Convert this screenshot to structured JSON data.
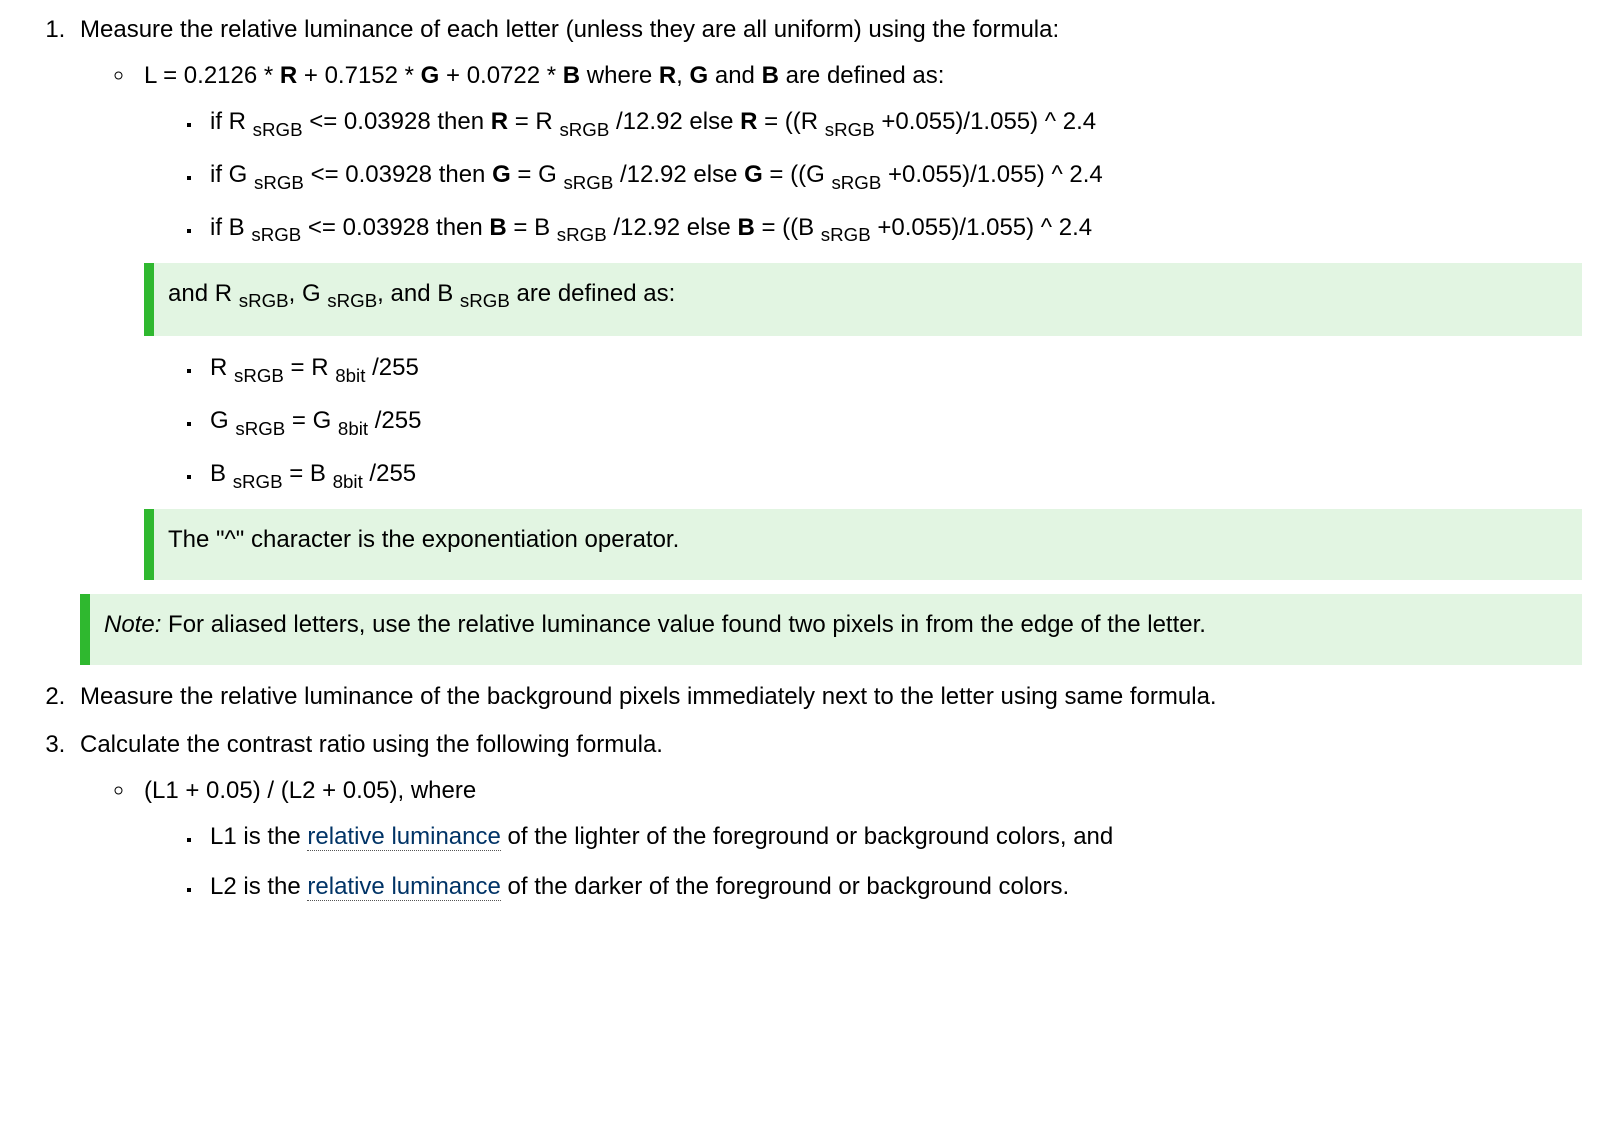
{
  "step1": {
    "text": "Measure the relative luminance of each letter (unless they are all uniform) using the formula:",
    "formula_pre": "L = 0.2126 * ",
    "formula_R": "R",
    "formula_mid1": " + 0.7152 * ",
    "formula_G": "G",
    "formula_mid2": " + 0.0722 * ",
    "formula_B": "B",
    "formula_where": " where ",
    "formula_R2": "R",
    "formula_comma": ", ",
    "formula_G2": "G",
    "formula_and": " and ",
    "formula_B2": "B",
    "formula_post": " are defined as:",
    "r_line_1": "if R ",
    "r_line_sub1": "sRGB",
    "r_line_2": " <= 0.03928 then ",
    "r_line_bold1": "R",
    "r_line_3": " = R ",
    "r_line_sub2": "sRGB",
    "r_line_4": " /12.92 else ",
    "r_line_bold2": "R",
    "r_line_5": " = ((R ",
    "r_line_sub3": "sRGB",
    "r_line_6": " +0.055)/1.055) ^ 2.4",
    "g_line_1": "if G ",
    "g_line_sub1": "sRGB",
    "g_line_2": " <= 0.03928 then ",
    "g_line_bold1": "G",
    "g_line_3": " = G ",
    "g_line_sub2": "sRGB",
    "g_line_4": " /12.92 else ",
    "g_line_bold2": "G",
    "g_line_5": " = ((G ",
    "g_line_sub3": "sRGB",
    "g_line_6": " +0.055)/1.055) ^ 2.4",
    "b_line_1": "if B ",
    "b_line_sub1": "sRGB",
    "b_line_2": " <= 0.03928 then ",
    "b_line_bold1": "B",
    "b_line_3": " = B ",
    "b_line_sub2": "sRGB",
    "b_line_4": " /12.92 else ",
    "b_line_bold2": "B",
    "b_line_5": " = ((B ",
    "b_line_sub3": "sRGB",
    "b_line_6": " +0.055)/1.055) ^ 2.4",
    "def_box_1": "and R ",
    "def_box_sub1": "sRGB",
    "def_box_2": ", G ",
    "def_box_sub2": "sRGB",
    "def_box_3": ", and B ",
    "def_box_sub3": "sRGB",
    "def_box_4": " are defined as:",
    "r8_1": "R ",
    "r8_sub1": "sRGB",
    "r8_2": " = R ",
    "r8_sub2": "8bit",
    "r8_3": " /255",
    "g8_1": "G ",
    "g8_sub1": "sRGB",
    "g8_2": " = G ",
    "g8_sub2": "8bit",
    "g8_3": " /255",
    "b8_1": "B ",
    "b8_sub1": "sRGB",
    "b8_2": " = B ",
    "b8_sub2": "8bit",
    "b8_3": " /255",
    "exp_box": "The \"^\" character is the exponentiation operator.",
    "note_label": "Note:",
    "note_text": " For aliased letters, use the relative luminance value found two pixels in from the edge of the letter."
  },
  "step2": "Measure the relative luminance of the background pixels immediately next to the letter using same formula.",
  "step3": {
    "text": "Calculate the contrast ratio using the following formula.",
    "ratio": "(L1 + 0.05) / (L2 + 0.05), where",
    "l1_pre": "L1 is the ",
    "l1_link": "relative luminance",
    "l1_post": " of the lighter of the foreground or background colors, and",
    "l2_pre": "L2 is the ",
    "l2_link": "relative luminance",
    "l2_post": " of the darker of the foreground or background colors."
  }
}
